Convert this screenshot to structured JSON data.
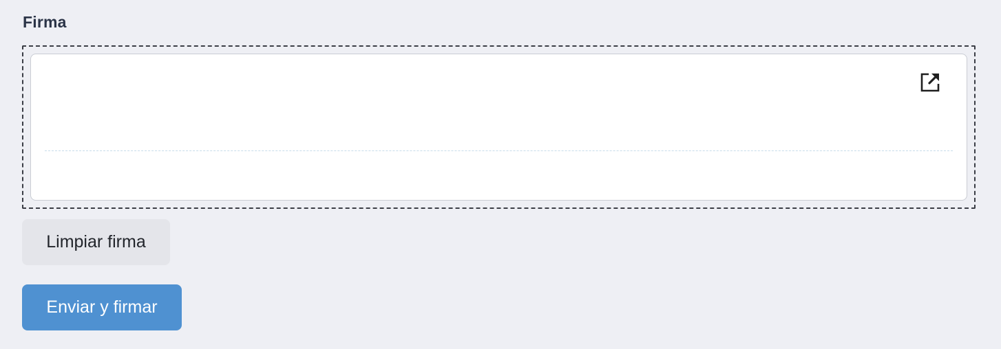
{
  "signature_field": {
    "label": "Firma",
    "expand_icon": "external-link-icon"
  },
  "actions": {
    "clear_label": "Limpiar firma",
    "submit_label": "Enviar y firmar"
  },
  "colors": {
    "background": "#eeeff4",
    "label_text": "#2b3447",
    "primary_button": "#4f91d1",
    "secondary_button": "#e4e5ea",
    "baseline": "#c6dbe9"
  }
}
